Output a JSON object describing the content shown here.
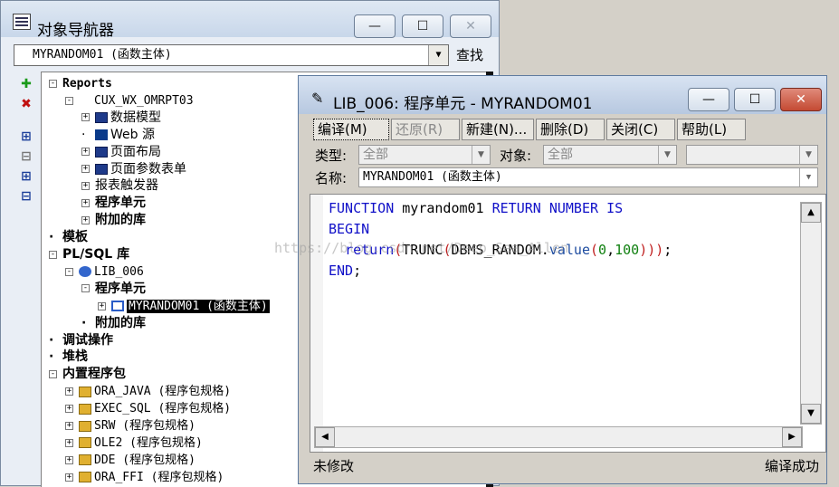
{
  "navigator": {
    "title": "对象导航器",
    "selector_value": "MYRANDOM01 (函数主体)",
    "find_label": "查找",
    "title_buttons": [
      "—",
      "☐",
      "✕"
    ]
  },
  "tree": [
    {
      "label": "Reports",
      "exp": "-",
      "indent": 0,
      "style": "mono bold"
    },
    {
      "label": "CUX_WX_OMRPT03",
      "exp": "-",
      "indent": 1,
      "icon": "report",
      "style": "mono"
    },
    {
      "label": "数据模型",
      "exp": "+",
      "indent": 2,
      "icon": "grid",
      "style": ""
    },
    {
      "label": "Web 源",
      "exp": "",
      "indent": 2,
      "icon": "web",
      "style": ""
    },
    {
      "label": "页面布局",
      "exp": "+",
      "indent": 2,
      "icon": "grid",
      "style": ""
    },
    {
      "label": "页面参数表单",
      "exp": "+",
      "indent": 2,
      "icon": "grid",
      "style": ""
    },
    {
      "label": "报表触发器",
      "exp": "+",
      "indent": 2,
      "icon": "",
      "style": ""
    },
    {
      "label": "程序单元",
      "exp": "+",
      "indent": 2,
      "icon": "",
      "style": "bold"
    },
    {
      "label": "附加的库",
      "exp": "+",
      "indent": 2,
      "icon": "",
      "style": "bold"
    },
    {
      "label": "模板",
      "exp": "",
      "indent": 0,
      "icon": "",
      "style": "bold"
    },
    {
      "label": "PL/SQL 库",
      "exp": "-",
      "indent": 0,
      "icon": "",
      "style": "bold"
    },
    {
      "label": "LIB_006",
      "exp": "-",
      "indent": 1,
      "icon": "db",
      "style": "mono"
    },
    {
      "label": "程序单元",
      "exp": "-",
      "indent": 2,
      "icon": "",
      "style": "bold"
    },
    {
      "label": "MYRANDOM01 (函数主体)",
      "exp": "+",
      "indent": 3,
      "icon": "fn",
      "style": "mono",
      "selected": true
    },
    {
      "label": "附加的库",
      "exp": "",
      "indent": 2,
      "icon": "",
      "style": "bold"
    },
    {
      "label": "调试操作",
      "exp": "",
      "indent": 0,
      "icon": "",
      "style": "bold"
    },
    {
      "label": "堆栈",
      "exp": "",
      "indent": 0,
      "icon": "",
      "style": "bold"
    },
    {
      "label": "内置程序包",
      "exp": "-",
      "indent": 0,
      "icon": "",
      "style": "bold"
    },
    {
      "label": "ORA_JAVA (程序包规格)",
      "exp": "+",
      "indent": 1,
      "icon": "pkg",
      "style": "mono"
    },
    {
      "label": "EXEC_SQL (程序包规格)",
      "exp": "+",
      "indent": 1,
      "icon": "pkg",
      "style": "mono"
    },
    {
      "label": "SRW (程序包规格)",
      "exp": "+",
      "indent": 1,
      "icon": "pkg",
      "style": "mono"
    },
    {
      "label": "OLE2 (程序包规格)",
      "exp": "+",
      "indent": 1,
      "icon": "pkg",
      "style": "mono"
    },
    {
      "label": "DDE (程序包规格)",
      "exp": "+",
      "indent": 1,
      "icon": "pkg",
      "style": "mono"
    },
    {
      "label": "ORA_FFI (程序包规格)",
      "exp": "+",
      "indent": 1,
      "icon": "pkg",
      "style": "mono"
    }
  ],
  "editor": {
    "title": "LIB_006: 程序单元 - MYRANDOM01",
    "buttons": {
      "compile": "编译(M)",
      "revert": "还原(R)",
      "new": "新建(N)...",
      "delete": "删除(D)",
      "close": "关闭(C)",
      "help": "帮助(L)"
    },
    "type_label": "类型:",
    "type_value": "全部",
    "object_label": "对象:",
    "object_value": "全部",
    "name_label": "名称:",
    "name_value": "MYRANDOM01 (函数主体)",
    "status_left": "未修改",
    "status_right": "编译成功",
    "watermark": "https://blog.csdn.net/Deep_Sea_Allen"
  }
}
